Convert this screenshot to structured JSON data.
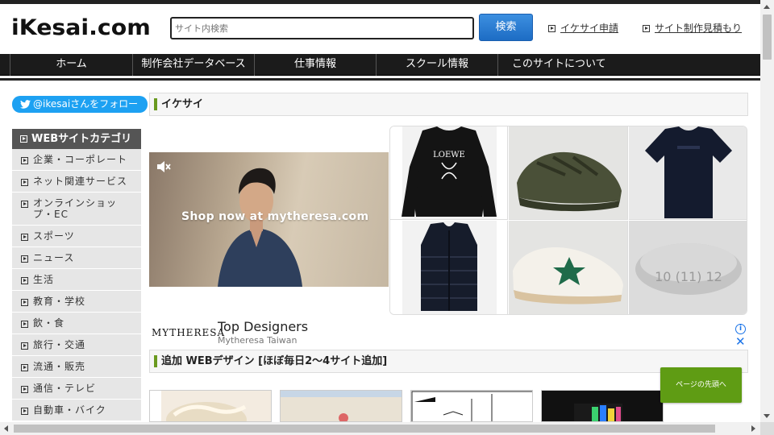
{
  "header": {
    "logo": "iKesai.com",
    "search_placeholder": "サイト内検索",
    "search_button": "検索",
    "links": [
      "イケサイ申請",
      "サイト制作見積もり"
    ]
  },
  "nav": {
    "items": [
      "ホーム",
      "制作会社データベース",
      "仕事情報",
      "スクール情報",
      "このサイトについて"
    ]
  },
  "twitter": {
    "label": "@ikesaiさんをフォロー"
  },
  "sidebar": {
    "heading": "WEBサイトカテゴリ",
    "items": [
      "企業・コーポレート",
      "ネット関連サービス",
      "オンラインショップ・EC",
      "スポーツ",
      "ニュース",
      "生活",
      "教育・学校",
      "飲・食",
      "旅行・交通",
      "流通・販売",
      "通信・テレビ",
      "自動車・バイク"
    ]
  },
  "sections": {
    "ikesai": "イケサイ",
    "added": "追加 WEBデザイン [ほぼ毎日2〜4サイト追加]"
  },
  "ad": {
    "banner_text": "Shop now at mytheresa.com",
    "brand": "MYTHERESA",
    "title": "Top Designers",
    "subtitle": "Mytheresa Taiwan",
    "info_glyph": "i",
    "close_glyph": "✕",
    "sweater_text": "LOEWE",
    "ring_text": "10 (11) 12"
  },
  "page_top": {
    "label": "ページの先頭へ"
  },
  "colors": {
    "accent_green": "#6a9a1f",
    "search_blue": "#1d6cc4",
    "twitter_blue": "#1da1f2",
    "pagetop_green": "#5f9c14",
    "nav_dark": "#1b1b1b"
  }
}
